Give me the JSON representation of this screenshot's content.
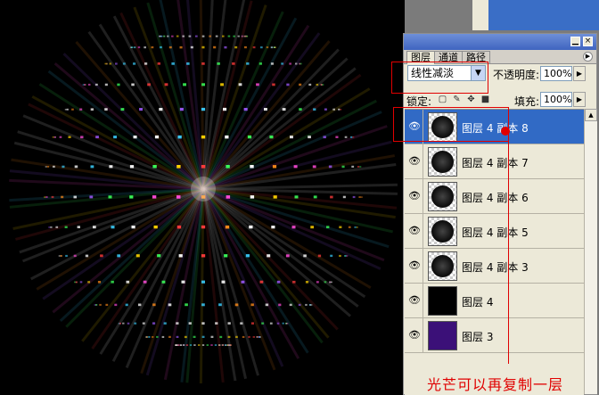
{
  "panel": {
    "tabs": [
      {
        "label": "图层",
        "active": true
      },
      {
        "label": "通道",
        "active": false
      },
      {
        "label": "路径",
        "active": false
      }
    ],
    "blend_mode": "线性减淡",
    "opacity_label": "不透明度:",
    "opacity_value": "100%",
    "lock_label": "锁定:",
    "fill_label": "填充:",
    "fill_value": "100%"
  },
  "layers": [
    {
      "name": "图层 4 副本 8",
      "thumb": "sphere-checker",
      "selected": true
    },
    {
      "name": "图层 4 副本 7",
      "thumb": "sphere-checker",
      "selected": false
    },
    {
      "name": "图层 4 副本 6",
      "thumb": "sphere-checker",
      "selected": false
    },
    {
      "name": "图层 4 副本 5",
      "thumb": "sphere-checker",
      "selected": false
    },
    {
      "name": "图层 4 副本 3",
      "thumb": "sphere-checker",
      "selected": false
    },
    {
      "name": "图层 4",
      "thumb": "black",
      "selected": false
    },
    {
      "name": "图层 3",
      "thumb": "purple",
      "selected": false
    }
  ],
  "annotation": {
    "text": "光芒可以再复制一层"
  },
  "colors": {
    "selected_layer": "#316ac5",
    "annotation": "#e00000",
    "purple_thumb": "#3b1078"
  }
}
